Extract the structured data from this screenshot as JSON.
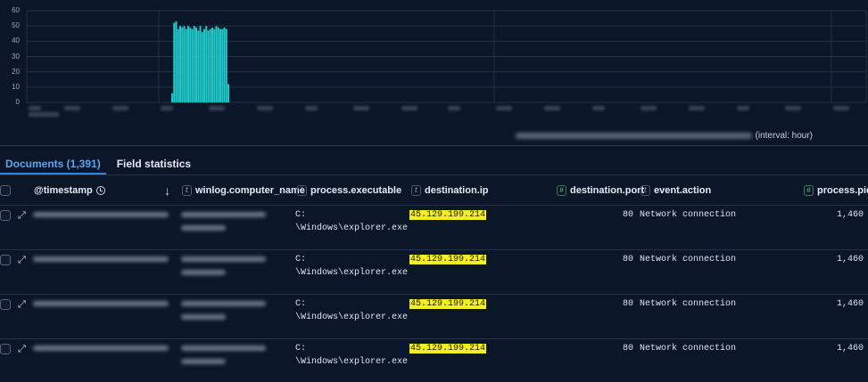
{
  "histogram": {
    "y_ticks": [
      "60",
      "50",
      "40",
      "30",
      "20",
      "10",
      "0"
    ],
    "y_max": 60,
    "bar_values": [
      6,
      52,
      53,
      48,
      50,
      49,
      50,
      48,
      50,
      49,
      48,
      50,
      49,
      47,
      50,
      46,
      48,
      50,
      47,
      48,
      49,
      48,
      50,
      49,
      48,
      48,
      49,
      48,
      12
    ],
    "bar_color": "#1fc9c9",
    "interval_label": "(interval: hour)"
  },
  "tabs": {
    "documents": "Documents (1,391)",
    "field_statistics": "Field statistics"
  },
  "columns": {
    "timestamp": "@timestamp",
    "computer_name": "winlog.computer_name",
    "executable": "process.executable",
    "dest_ip": "destination.ip",
    "dest_port": "destination.port",
    "event_action": "event.action",
    "pid": "process.pid"
  },
  "type_badges": {
    "text": "t",
    "number": "#"
  },
  "icons": {
    "expand": "⤢",
    "sort": "↓"
  },
  "rows": [
    {
      "exe_line1": "C:",
      "exe_line2": "\\Windows\\explorer.exe",
      "ip": "45.129.199.214",
      "port": "80",
      "action": "Network connection",
      "pid": "1,460"
    },
    {
      "exe_line1": "C:",
      "exe_line2": "\\Windows\\explorer.exe",
      "ip": "45.129.199.214",
      "port": "80",
      "action": "Network connection",
      "pid": "1,460"
    },
    {
      "exe_line1": "C:",
      "exe_line2": "\\Windows\\explorer.exe",
      "ip": "45.129.199.214",
      "port": "80",
      "action": "Network connection",
      "pid": "1,460"
    },
    {
      "exe_line1": "C:",
      "exe_line2": "\\Windows\\explorer.exe",
      "ip": "45.129.199.214",
      "port": "80",
      "action": "Network connection",
      "pid": "1,460"
    }
  ],
  "colors": {
    "background": "#0b1628",
    "accent": "#5ba6f0",
    "highlight": "#f5ef1f",
    "number_badge": "#4fc38a"
  }
}
